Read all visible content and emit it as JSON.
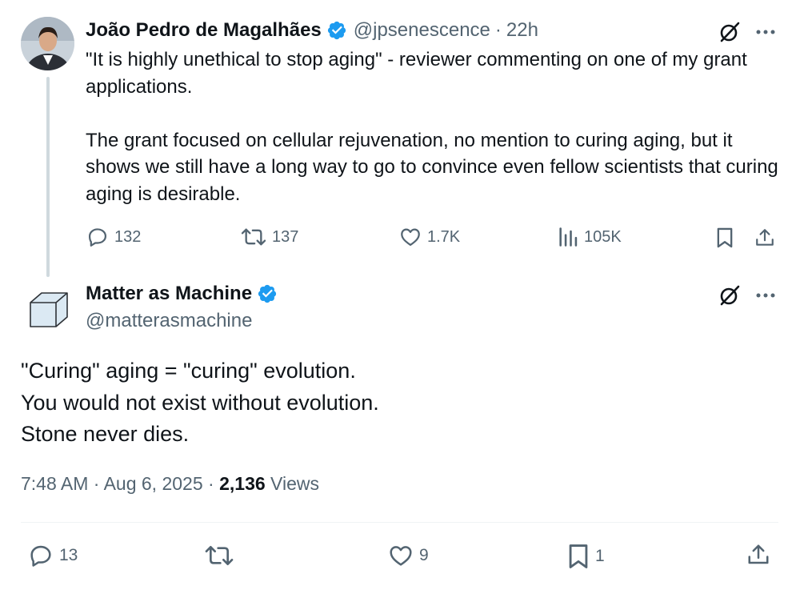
{
  "reply_tweet": {
    "author_name": "João Pedro de Magalhães",
    "handle": "@jpsenescence",
    "separator": "·",
    "time": "22h",
    "text": "\"It is highly unethical to stop aging\" - reviewer commenting on one of my grant applications.\n\nThe grant focused on cellular rejuvenation, no mention to curing aging, but it shows we still have a long way to go to convince even fellow scientists that curing aging is desirable.",
    "stats": {
      "replies": "132",
      "reposts": "137",
      "likes": "1.7K",
      "views": "105K"
    }
  },
  "main_tweet": {
    "author_name": "Matter as Machine",
    "handle": "@matterasmachine",
    "text": "\"Curing\" aging = \"curing\" evolution.\nYou would not exist without evolution.\nStone never dies.",
    "meta": {
      "time": "7:48 AM",
      "sep1": "·",
      "date": "Aug 6, 2025",
      "sep2": "·",
      "views_count": "2,136",
      "views_label": "Views"
    },
    "stats": {
      "replies": "13",
      "likes": "9",
      "bookmarks": "1"
    }
  },
  "colors": {
    "text": "#0f1419",
    "secondary": "#536471",
    "verified": "#1d9bf0",
    "thread_line": "#cfd9de"
  },
  "icons": [
    "verified-badge-icon",
    "grok-icon",
    "more-icon",
    "reply-icon",
    "repost-icon",
    "like-icon",
    "views-icon",
    "bookmark-icon",
    "share-icon",
    "cube-avatar-icon"
  ]
}
